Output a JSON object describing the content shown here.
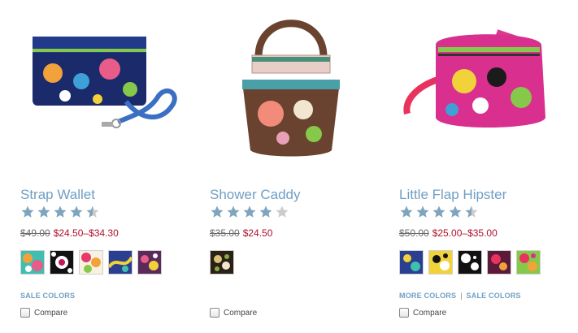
{
  "products": [
    {
      "name": "Strap Wallet",
      "rating": 4.5,
      "rating_max": 5,
      "original_price": "$49.00",
      "sale_price": "$24.50–$34.30",
      "swatch_count": 5,
      "links": [
        "SALE COLORS"
      ],
      "compare_label": "Compare"
    },
    {
      "name": "Shower Caddy",
      "rating": 4,
      "rating_max": 5,
      "original_price": "$35.00",
      "sale_price": "$24.50",
      "swatch_count": 1,
      "links": [],
      "compare_label": "Compare"
    },
    {
      "name": "Little Flap Hipster",
      "rating": 4.5,
      "rating_max": 5,
      "original_price": "$50.00",
      "sale_price": "$25.00–$35.00",
      "swatch_count": 5,
      "links": [
        "MORE COLORS",
        "SALE COLORS"
      ],
      "compare_label": "Compare"
    }
  ],
  "colors": {
    "link": "#6f9fc4",
    "sale_price": "#b0102a",
    "original_price": "#6b6b6b",
    "star_filled": "#7fa4bd",
    "star_empty": "#cccccc"
  }
}
